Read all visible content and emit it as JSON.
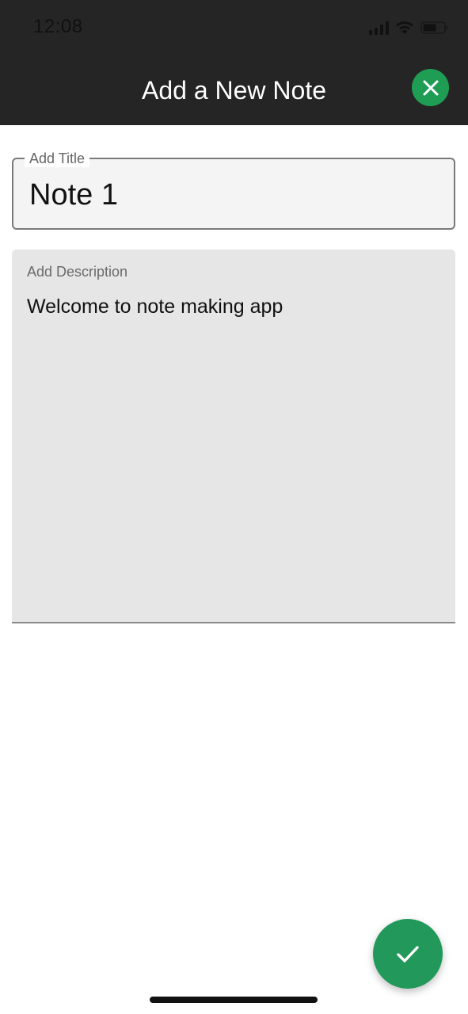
{
  "status_bar": {
    "time": "12:08",
    "icons": [
      "signal-icon",
      "wifi-icon",
      "battery-icon"
    ]
  },
  "header": {
    "title": "Add a New Note",
    "close_icon": "close-icon",
    "bg_color": "#252525",
    "accent_color": "#1f9d55"
  },
  "form": {
    "title_label": "Add Title",
    "title_value": "Note 1",
    "description_label": "Add Description",
    "description_value": "Welcome to note making app"
  },
  "fab": {
    "icon": "check-icon",
    "color": "#22995a"
  }
}
